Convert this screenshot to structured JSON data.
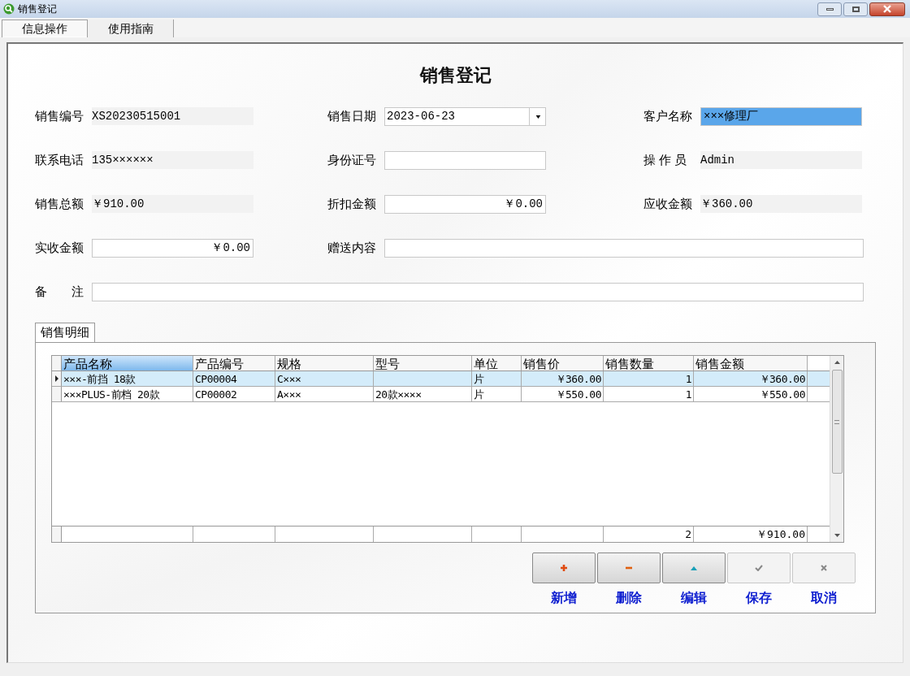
{
  "window": {
    "title": "销售登记"
  },
  "tabs": [
    {
      "label": "信息操作",
      "selected": true
    },
    {
      "label": "使用指南",
      "selected": false
    }
  ],
  "form": {
    "title": "销售登记",
    "rows": [
      [
        {
          "label": "销售编号",
          "kind": "display",
          "value": "XS20230515001",
          "selected": false
        },
        {
          "label": "销售日期",
          "kind": "date",
          "value": "2023-06-23",
          "selected": false
        },
        {
          "label": "客户名称",
          "kind": "input",
          "value": "×××修理厂",
          "selected": true
        }
      ],
      [
        {
          "label": "联系电话",
          "kind": "display",
          "value": "135××××××",
          "selected": false
        },
        {
          "label": "身份证号",
          "kind": "input",
          "selected": false
        },
        {
          "label": "操 作 员",
          "kind": "display",
          "value": "Admin",
          "selected": false
        }
      ],
      [
        {
          "label": "销售总额",
          "kind": "display",
          "value": "￥910.00",
          "selected": false
        },
        {
          "label": "折扣金额",
          "kind": "money",
          "value": "￥0.00",
          "selected": false
        },
        {
          "label": "应收金额",
          "kind": "display",
          "value": "￥360.00",
          "selected": false
        }
      ],
      [
        {
          "label": "实收金额",
          "kind": "money",
          "value": "￥0.00",
          "selected": false
        },
        {
          "label": "赠送内容",
          "kind": "input",
          "selected": false
        }
      ],
      [
        {
          "label": "备　　注",
          "kind": "input",
          "selected": false
        }
      ]
    ]
  },
  "detail_tab": {
    "label": "销售明细",
    "selected": true
  },
  "table": {
    "columns": [
      {
        "label": "产品名称",
        "numeric": false
      },
      {
        "label": "产品编号",
        "numeric": false
      },
      {
        "label": "规格",
        "numeric": false
      },
      {
        "label": "型号",
        "numeric": false
      },
      {
        "label": "单位",
        "numeric": false
      },
      {
        "label": "销售价",
        "numeric": true
      },
      {
        "label": "销售数量",
        "numeric": true
      },
      {
        "label": "销售金额",
        "numeric": true
      }
    ],
    "rows": [
      {
        "selected": true,
        "cells": [
          "×××-前挡 18款",
          "CP00004",
          "C×××",
          "",
          "片",
          "￥360.00",
          "1",
          "￥360.00"
        ]
      },
      {
        "selected": false,
        "cells": [
          "×××PLUS-前档 20款",
          "CP00002",
          "A×××",
          "20款××××",
          "片",
          "￥550.00",
          "1",
          "￥550.00"
        ]
      }
    ],
    "footer": {
      "quantity_total": "2",
      "amount_total": "￥910.00"
    }
  },
  "buttons": [
    {
      "label": "新增",
      "kind": "add",
      "disabled": false
    },
    {
      "label": "删除",
      "kind": "delete",
      "disabled": false
    },
    {
      "label": "编辑",
      "kind": "edit",
      "disabled": false
    },
    {
      "label": "保存",
      "kind": "save",
      "disabled": true
    },
    {
      "label": "取消",
      "kind": "cancel",
      "disabled": true
    }
  ]
}
